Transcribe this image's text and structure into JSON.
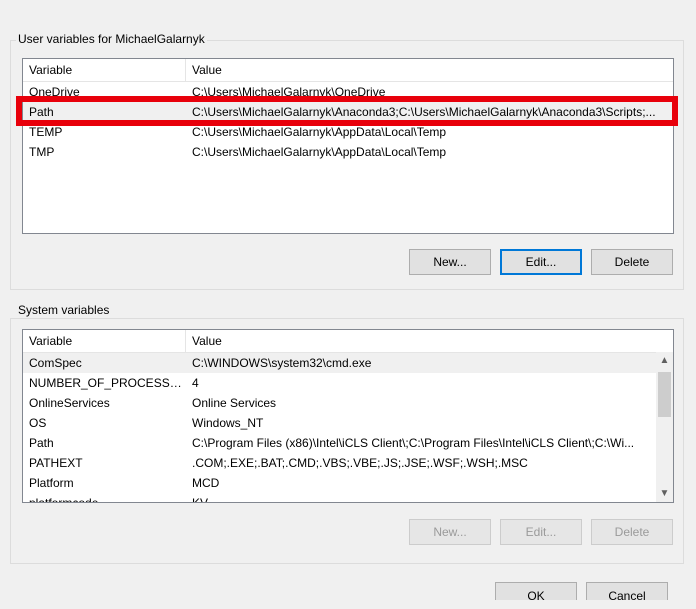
{
  "user_section": {
    "title": "User variables for MichaelGalarnyk",
    "headers": {
      "variable": "Variable",
      "value": "Value"
    },
    "rows": [
      {
        "variable": "OneDrive",
        "value": "C:\\Users\\MichaelGalarnyk\\OneDrive"
      },
      {
        "variable": "Path",
        "value": "C:\\Users\\MichaelGalarnyk\\Anaconda3;C:\\Users\\MichaelGalarnyk\\Anaconda3\\Scripts;..."
      },
      {
        "variable": "TEMP",
        "value": "C:\\Users\\MichaelGalarnyk\\AppData\\Local\\Temp"
      },
      {
        "variable": "TMP",
        "value": "C:\\Users\\MichaelGalarnyk\\AppData\\Local\\Temp"
      }
    ],
    "buttons": {
      "new": "New...",
      "edit": "Edit...",
      "delete": "Delete"
    }
  },
  "system_section": {
    "title": "System variables",
    "headers": {
      "variable": "Variable",
      "value": "Value"
    },
    "rows": [
      {
        "variable": "ComSpec",
        "value": "C:\\WINDOWS\\system32\\cmd.exe"
      },
      {
        "variable": "NUMBER_OF_PROCESSORS",
        "value": "4"
      },
      {
        "variable": "OnlineServices",
        "value": "Online Services"
      },
      {
        "variable": "OS",
        "value": "Windows_NT"
      },
      {
        "variable": "Path",
        "value": "C:\\Program Files (x86)\\Intel\\iCLS Client\\;C:\\Program Files\\Intel\\iCLS Client\\;C:\\Wi..."
      },
      {
        "variable": "PATHEXT",
        "value": ".COM;.EXE;.BAT;.CMD;.VBS;.VBE;.JS;.JSE;.WSF;.WSH;.MSC"
      },
      {
        "variable": "Platform",
        "value": "MCD"
      },
      {
        "variable": "platformcode",
        "value": "KV"
      }
    ],
    "buttons": {
      "new": "New...",
      "edit": "Edit...",
      "delete": "Delete"
    }
  },
  "dialog_buttons": {
    "ok": "OK",
    "cancel": "Cancel"
  },
  "colors": {
    "highlight": "#e8000b",
    "focus": "#0078d7"
  }
}
